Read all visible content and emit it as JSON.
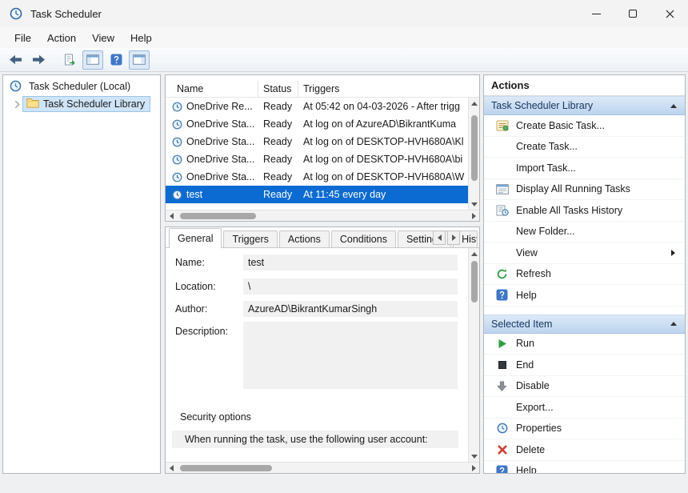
{
  "window": {
    "title": "Task Scheduler"
  },
  "menu": {
    "items": [
      "File",
      "Action",
      "View",
      "Help"
    ]
  },
  "tree": {
    "root_label": "Task Scheduler (Local)",
    "library_label": "Task Scheduler Library"
  },
  "task_list": {
    "columns": {
      "name": "Name",
      "status": "Status",
      "triggers": "Triggers"
    },
    "rows": [
      {
        "name": "OneDrive Re...",
        "status": "Ready",
        "triggers": "At 05:42 on 04-03-2026 - After trigg"
      },
      {
        "name": "OneDrive Sta...",
        "status": "Ready",
        "triggers": "At log on of AzureAD\\BikrantKuma"
      },
      {
        "name": "OneDrive Sta...",
        "status": "Ready",
        "triggers": "At log on of DESKTOP-HVH680A\\Kl"
      },
      {
        "name": "OneDrive Sta...",
        "status": "Ready",
        "triggers": "At log on of DESKTOP-HVH680A\\bi"
      },
      {
        "name": "OneDrive Sta...",
        "status": "Ready",
        "triggers": "At log on of DESKTOP-HVH680A\\W"
      },
      {
        "name": "test",
        "status": "Ready",
        "triggers": "At 11:45 every day"
      }
    ],
    "selected_row_index": 5,
    "selection_color": "#0b6bd3"
  },
  "details": {
    "tabs": [
      "General",
      "Triggers",
      "Actions",
      "Conditions",
      "Settings",
      "Histo"
    ],
    "active_tab": "General",
    "fields": {
      "name_label": "Name:",
      "name_value": "test",
      "location_label": "Location:",
      "location_value": "\\",
      "author_label": "Author:",
      "author_value": "AzureAD\\BikrantKumarSingh",
      "description_label": "Description:",
      "description_value": ""
    },
    "security": {
      "heading": "Security options",
      "line1": "When running the task, use the following user account:"
    }
  },
  "actions_pane": {
    "title": "Actions",
    "sections": [
      {
        "header": "Task Scheduler Library",
        "items": [
          {
            "label": "Create Basic Task...",
            "icon": "create-basic-task-icon"
          },
          {
            "label": "Create Task...",
            "icon": ""
          },
          {
            "label": "Import Task...",
            "icon": ""
          },
          {
            "label": "Display All Running Tasks",
            "icon": "running-tasks-icon"
          },
          {
            "label": "Enable All Tasks History",
            "icon": "history-icon"
          },
          {
            "label": "New Folder...",
            "icon": ""
          },
          {
            "label": "View",
            "icon": "",
            "submenu": true
          },
          {
            "label": "Refresh",
            "icon": "refresh-icon"
          },
          {
            "label": "Help",
            "icon": "help-icon"
          }
        ]
      },
      {
        "header": "Selected Item",
        "items": [
          {
            "label": "Run",
            "icon": "run-icon"
          },
          {
            "label": "End",
            "icon": "end-icon"
          },
          {
            "label": "Disable",
            "icon": "disable-icon"
          },
          {
            "label": "Export...",
            "icon": ""
          },
          {
            "label": "Properties",
            "icon": "properties-icon"
          },
          {
            "label": "Delete",
            "icon": "delete-icon"
          },
          {
            "label": "Help",
            "icon": "help-icon"
          }
        ]
      }
    ]
  }
}
